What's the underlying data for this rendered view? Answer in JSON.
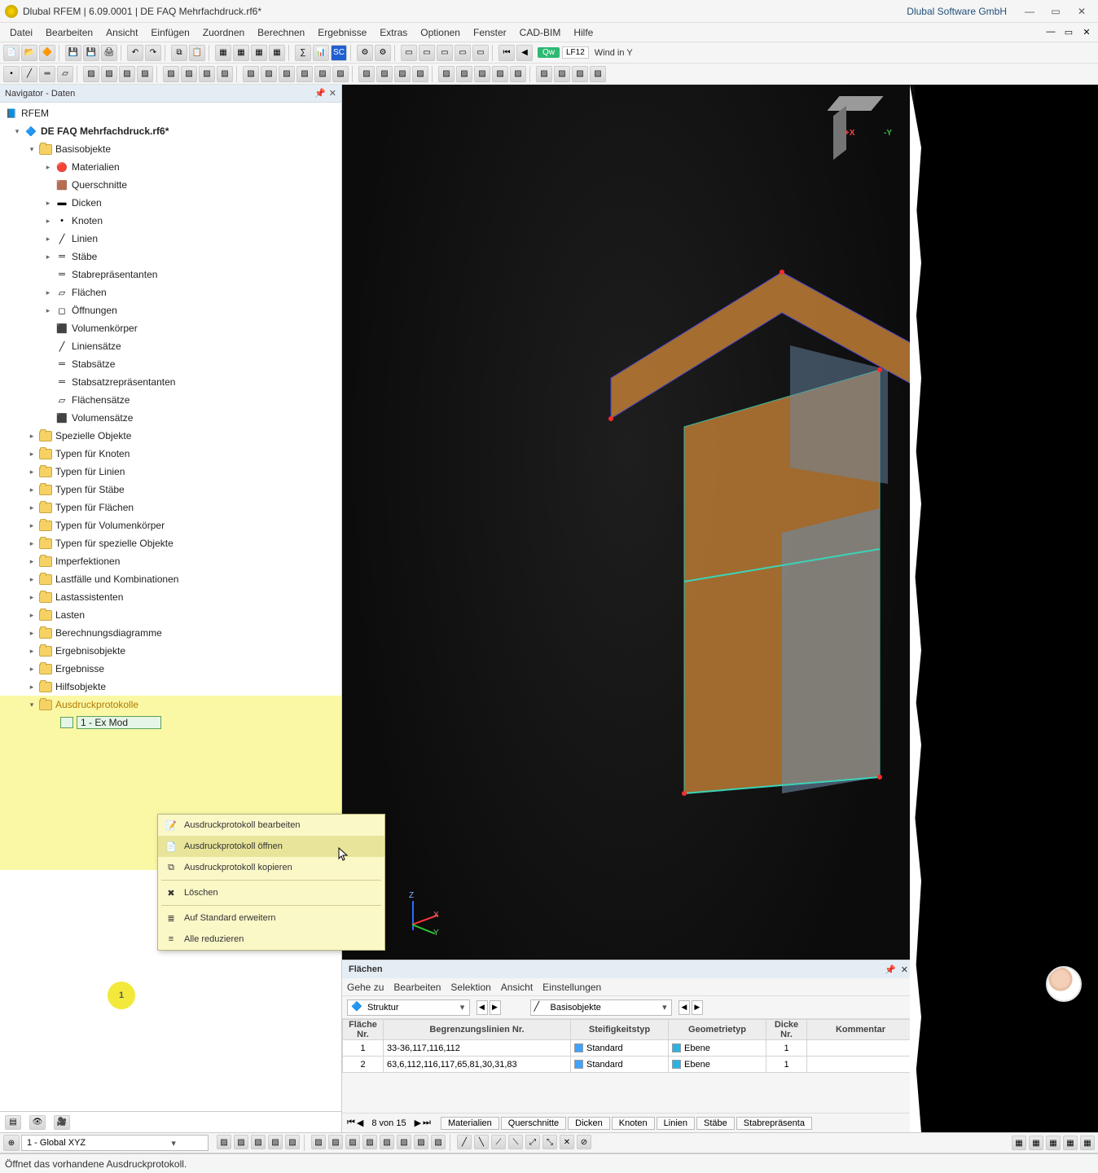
{
  "titlebar": {
    "title": "Dlubal RFEM | 6.09.0001 | DE FAQ Mehrfachdruck.rf6*",
    "company": "Dlubal Software GmbH"
  },
  "menu": [
    "Datei",
    "Bearbeiten",
    "Ansicht",
    "Einfügen",
    "Zuordnen",
    "Berechnen",
    "Ergebnisse",
    "Extras",
    "Optionen",
    "Fenster",
    "CAD-BIM",
    "Hilfe"
  ],
  "loadcase": {
    "qw": "Qw",
    "code": "LF12",
    "desc": "Wind in Y"
  },
  "navigator": {
    "title": "Navigator - Daten",
    "root": "RFEM",
    "model": "DE FAQ Mehrfachdruck.rf6*",
    "basis": "Basisobjekte",
    "basisItems": [
      "Materialien",
      "Querschnitte",
      "Dicken",
      "Knoten",
      "Linien",
      "Stäbe",
      "Stabrepräsentanten",
      "Flächen",
      "Öffnungen",
      "Volumenkörper",
      "Liniensätze",
      "Stabsätze",
      "Stabsatzrepräsentanten",
      "Flächensätze",
      "Volumensätze"
    ],
    "folders": [
      "Spezielle Objekte",
      "Typen für Knoten",
      "Typen für Linien",
      "Typen für Stäbe",
      "Typen für Flächen",
      "Typen für Volumenkörper",
      "Typen für spezielle Objekte",
      "Imperfektionen",
      "Lastfälle und Kombinationen",
      "Lastassistenten",
      "Lasten",
      "Berechnungsdiagramme",
      "Ergebnisobjekte",
      "Ergebnisse",
      "Hilfsobjekte"
    ],
    "protocols": "Ausdruckprotokolle",
    "protocolItem": "1 - Ex Mod"
  },
  "contextMenu": {
    "items": [
      "Ausdruckprotokoll bearbeiten",
      "Ausdruckprotokoll öffnen",
      "Ausdruckprotokoll kopieren",
      "Löschen",
      "Auf Standard erweitern",
      "Alle reduzieren"
    ]
  },
  "bottomPanel": {
    "title": "Flächen",
    "menu": [
      "Gehe zu",
      "Bearbeiten",
      "Selektion",
      "Ansicht",
      "Einstellungen"
    ],
    "combo1": "Struktur",
    "combo2": "Basisobjekte",
    "headers": [
      "Fläche Nr.",
      "Begrenzungslinien Nr.",
      "Steifigkeitstyp",
      "Geometrietyp",
      "Dicke Nr.",
      "Kommentar"
    ],
    "rows": [
      {
        "id": "1",
        "lines": "33-36,117,116,112",
        "stiff": "Standard",
        "geom": "Ebene",
        "thk": "1"
      },
      {
        "id": "2",
        "lines": "63,6,112,116,117,65,81,30,31,83",
        "stiff": "Standard",
        "geom": "Ebene",
        "thk": "1"
      }
    ],
    "footer": {
      "pos": "8 von 15",
      "tabs": [
        "Materialien",
        "Querschnitte",
        "Dicken",
        "Knoten",
        "Linien",
        "Stäbe",
        "Stabrepräsenta"
      ]
    }
  },
  "coordSys": "1 - Global XYZ",
  "statusMsg": "Öffnet das vorhandene Ausdruckprotokoll.",
  "badge": "1",
  "axes": {
    "x": "X",
    "y": "Y",
    "z": "Z"
  }
}
